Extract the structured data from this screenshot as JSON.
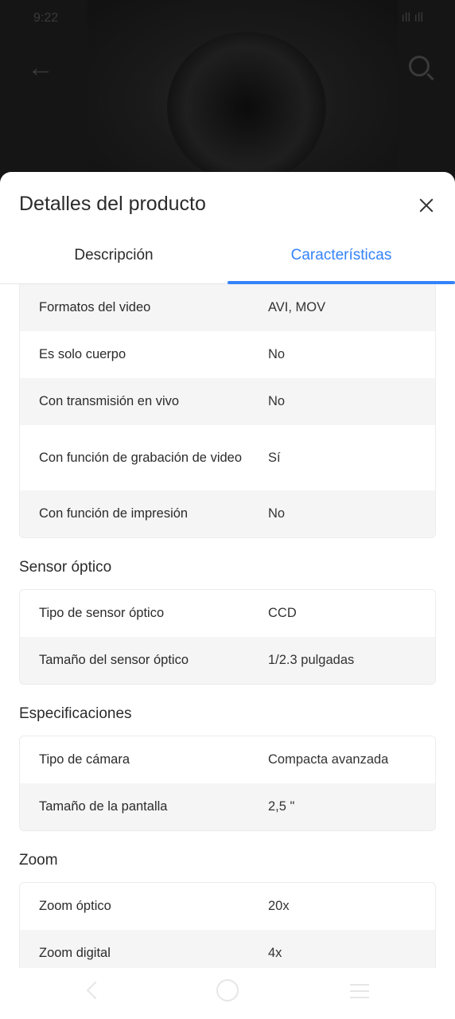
{
  "status_bar": {
    "time": "9:22",
    "signal": "ıll ıll"
  },
  "sheet": {
    "title": "Detalles del producto"
  },
  "tabs": [
    {
      "label": "Descripción",
      "active": false
    },
    {
      "label": "Características",
      "active": true
    }
  ],
  "general": {
    "rows": [
      {
        "key": "Formatos del video",
        "value": "AVI, MOV"
      },
      {
        "key": "Es solo cuerpo",
        "value": "No"
      },
      {
        "key": "Con transmisión en vivo",
        "value": "No"
      },
      {
        "key": "Con función de grabación de video",
        "value": "Sí"
      },
      {
        "key": "Con función de impresión",
        "value": "No"
      }
    ]
  },
  "sensor": {
    "title": "Sensor óptico",
    "rows": [
      {
        "key": "Tipo de sensor óptico",
        "value": "CCD"
      },
      {
        "key": "Tamaño del sensor óptico",
        "value": "1/2.3 pulgadas"
      }
    ]
  },
  "specs": {
    "title": "Especificaciones",
    "rows": [
      {
        "key": "Tipo de cámara",
        "value": "Compacta avanzada"
      },
      {
        "key": "Tamaño de la pantalla",
        "value": "2,5 \""
      }
    ]
  },
  "zoom": {
    "title": "Zoom",
    "rows": [
      {
        "key": "Zoom óptico",
        "value": "20x"
      },
      {
        "key": "Zoom digital",
        "value": "4x"
      }
    ]
  },
  "colors": {
    "accent": "#3483fa",
    "row_alt": "#f5f5f5"
  }
}
